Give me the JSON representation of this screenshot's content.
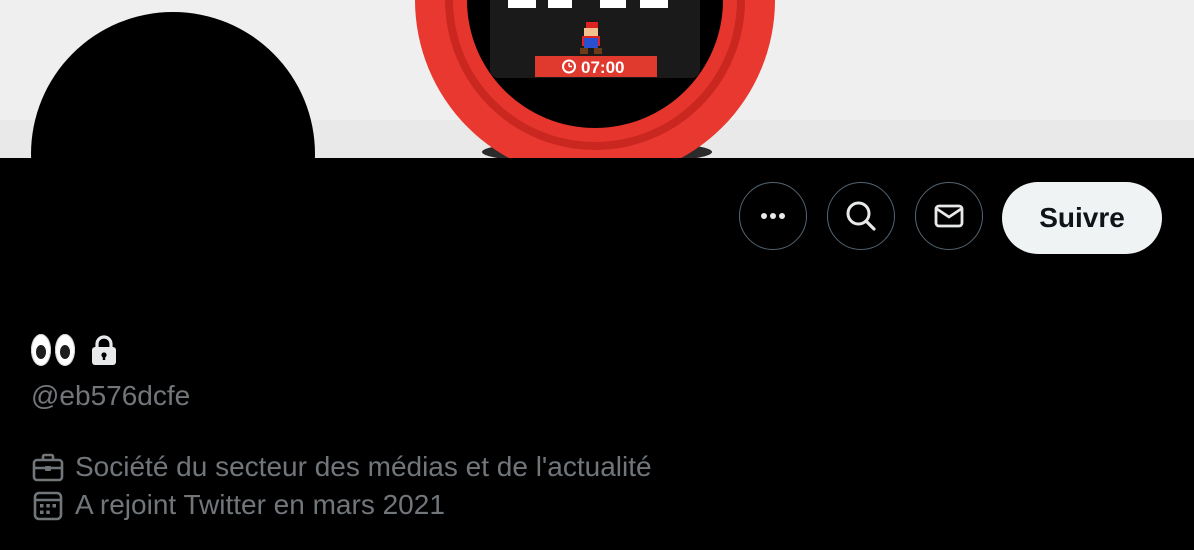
{
  "banner": {
    "device_time": "07:00",
    "colors": {
      "ring": "#e8382f",
      "background": "#efefef"
    }
  },
  "profile": {
    "display_name_icons": [
      "eyes-emoji",
      "lock-icon"
    ],
    "handle": "@eb576dcfe",
    "category": "Société du secteur des médias et de l'actualité",
    "joined": "A rejoint Twitter en mars 2021"
  },
  "actions": {
    "more_icon": "ellipsis-icon",
    "search_icon": "search-icon",
    "message_icon": "envelope-icon",
    "follow_label": "Suivre"
  },
  "colors": {
    "background": "#000000",
    "secondary_text": "#71767b",
    "button_border": "#536471",
    "follow_button_bg": "#eff3f4",
    "follow_button_text": "#0f1419"
  }
}
